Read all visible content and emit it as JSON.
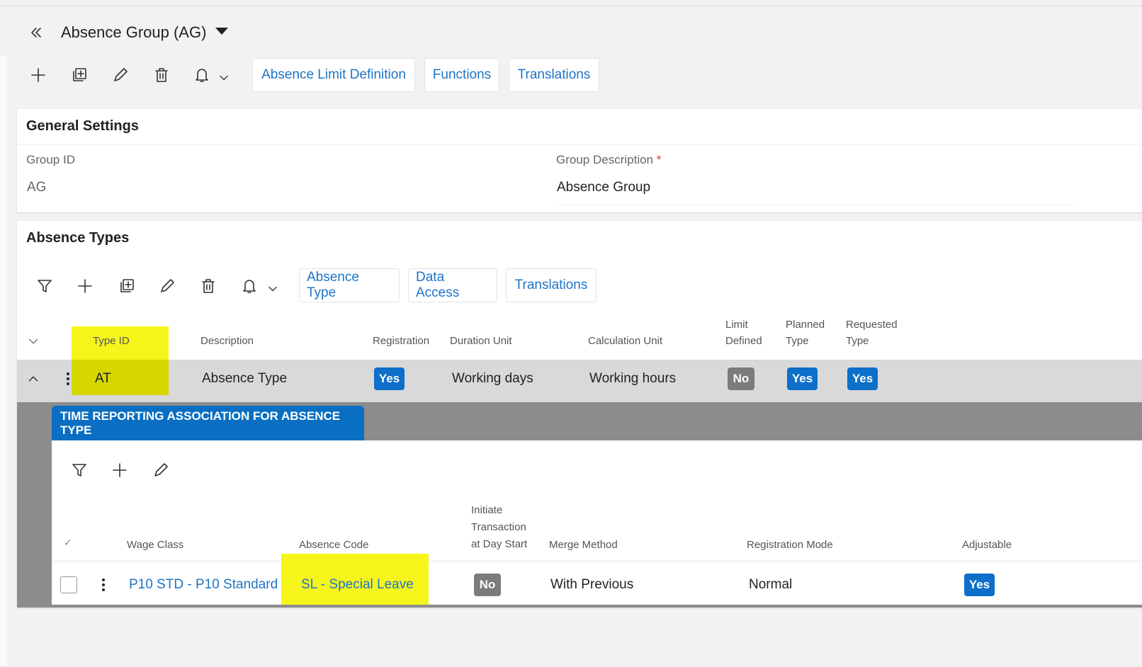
{
  "page": {
    "title": "Absence Group (AG)",
    "buttons": {
      "absence_limit_definition": "Absence Limit Definition",
      "functions": "Functions",
      "translations": "Translations"
    }
  },
  "general_settings": {
    "title": "General Settings",
    "group_id_label": "Group ID",
    "group_id_value": "AG",
    "group_description_label": "Group Description",
    "required_mark": "*",
    "group_description_value": "Absence Group"
  },
  "absence_types": {
    "title": "Absence Types",
    "buttons": {
      "absence_type": "Absence Type",
      "data_access": "Data Access",
      "translations": "Translations"
    },
    "columns": {
      "type_id": "Type ID",
      "description": "Description",
      "registration": "Registration",
      "duration_unit": "Duration Unit",
      "calculation_unit": "Calculation Unit",
      "limit_defined_1": "Limit",
      "limit_defined_2": "Defined",
      "planned_type_1": "Planned",
      "planned_type_2": "Type",
      "requested_type_1": "Requested",
      "requested_type_2": "Type"
    },
    "row": {
      "type_id": "AT",
      "description": "Absence Type",
      "registration": "Yes",
      "duration_unit": "Working days",
      "calculation_unit": "Working hours",
      "limit_defined": "No",
      "planned_type": "Yes",
      "requested_type": "Yes"
    }
  },
  "time_reporting": {
    "tab_title": "TIME REPORTING ASSOCIATION FOR ABSENCE TYPE",
    "columns": {
      "wage_class": "Wage Class",
      "absence_code": "Absence Code",
      "initiate_1": "Initiate",
      "initiate_2": "Transaction",
      "initiate_3": "at Day Start",
      "merge_method": "Merge Method",
      "registration_mode": "Registration Mode",
      "adjustable": "Adjustable"
    },
    "row": {
      "wage_class": "P10 STD - P10 Standard",
      "absence_code": "SL - Special Leave",
      "initiate": "No",
      "merge_method": "With Previous",
      "registration_mode": "Normal",
      "adjustable": "Yes"
    }
  },
  "colors": {
    "accent": "#1f74c6",
    "badge_yes": "#0d6fc9",
    "badge_no": "#7b7b7b",
    "highlight": "#f5f51b",
    "tab_blue": "#0a6fc2"
  }
}
